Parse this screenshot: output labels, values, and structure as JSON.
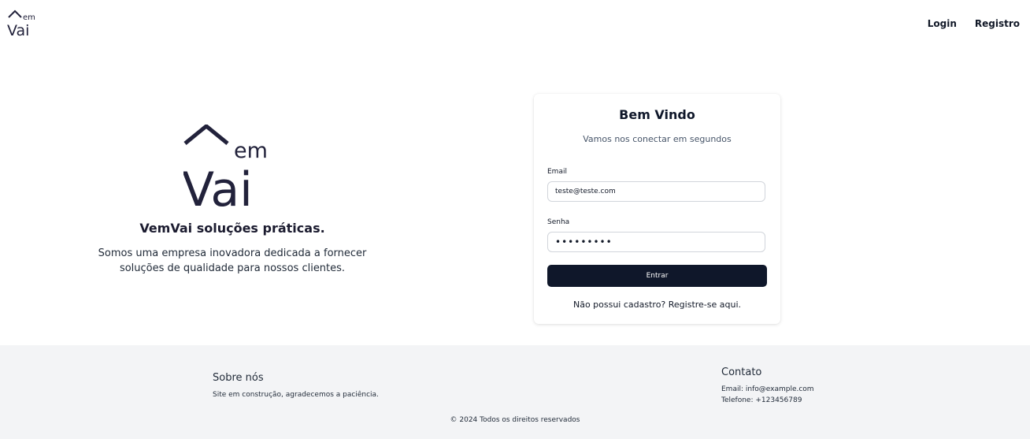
{
  "brand": {
    "logo_big": {
      "small": "em",
      "large": "Vai"
    },
    "logo_small": {
      "small": "em",
      "large": "Vai"
    },
    "color": "#22223b"
  },
  "nav": {
    "login": "Login",
    "register": "Registro"
  },
  "hero": {
    "title": "VemVai soluções práticas.",
    "line1": "Somos uma empresa inovadora dedicada a fornecer",
    "line2": "soluções de qualidade para nossos clientes."
  },
  "login_form": {
    "title": "Bem Vindo",
    "subtitle": "Vamos nos conectar em segundos",
    "email_label": "Email",
    "email_value": "teste@teste.com",
    "password_label": "Senha",
    "password_value": "•••••••••",
    "submit_label": "Entrar",
    "register_link": "Não possui cadastro? Registre-se aqui.",
    "button_color": "#0f172a"
  },
  "footer": {
    "about_title": "Sobre nós",
    "about_text": "Site em construção, agradecemos a paciência.",
    "contact_title": "Contato",
    "email": "Email: info@example.com",
    "phone": "Telefone: +123456789",
    "copyright": "© 2024 Todos os direitos reservados",
    "background": "#f3f4f6"
  }
}
